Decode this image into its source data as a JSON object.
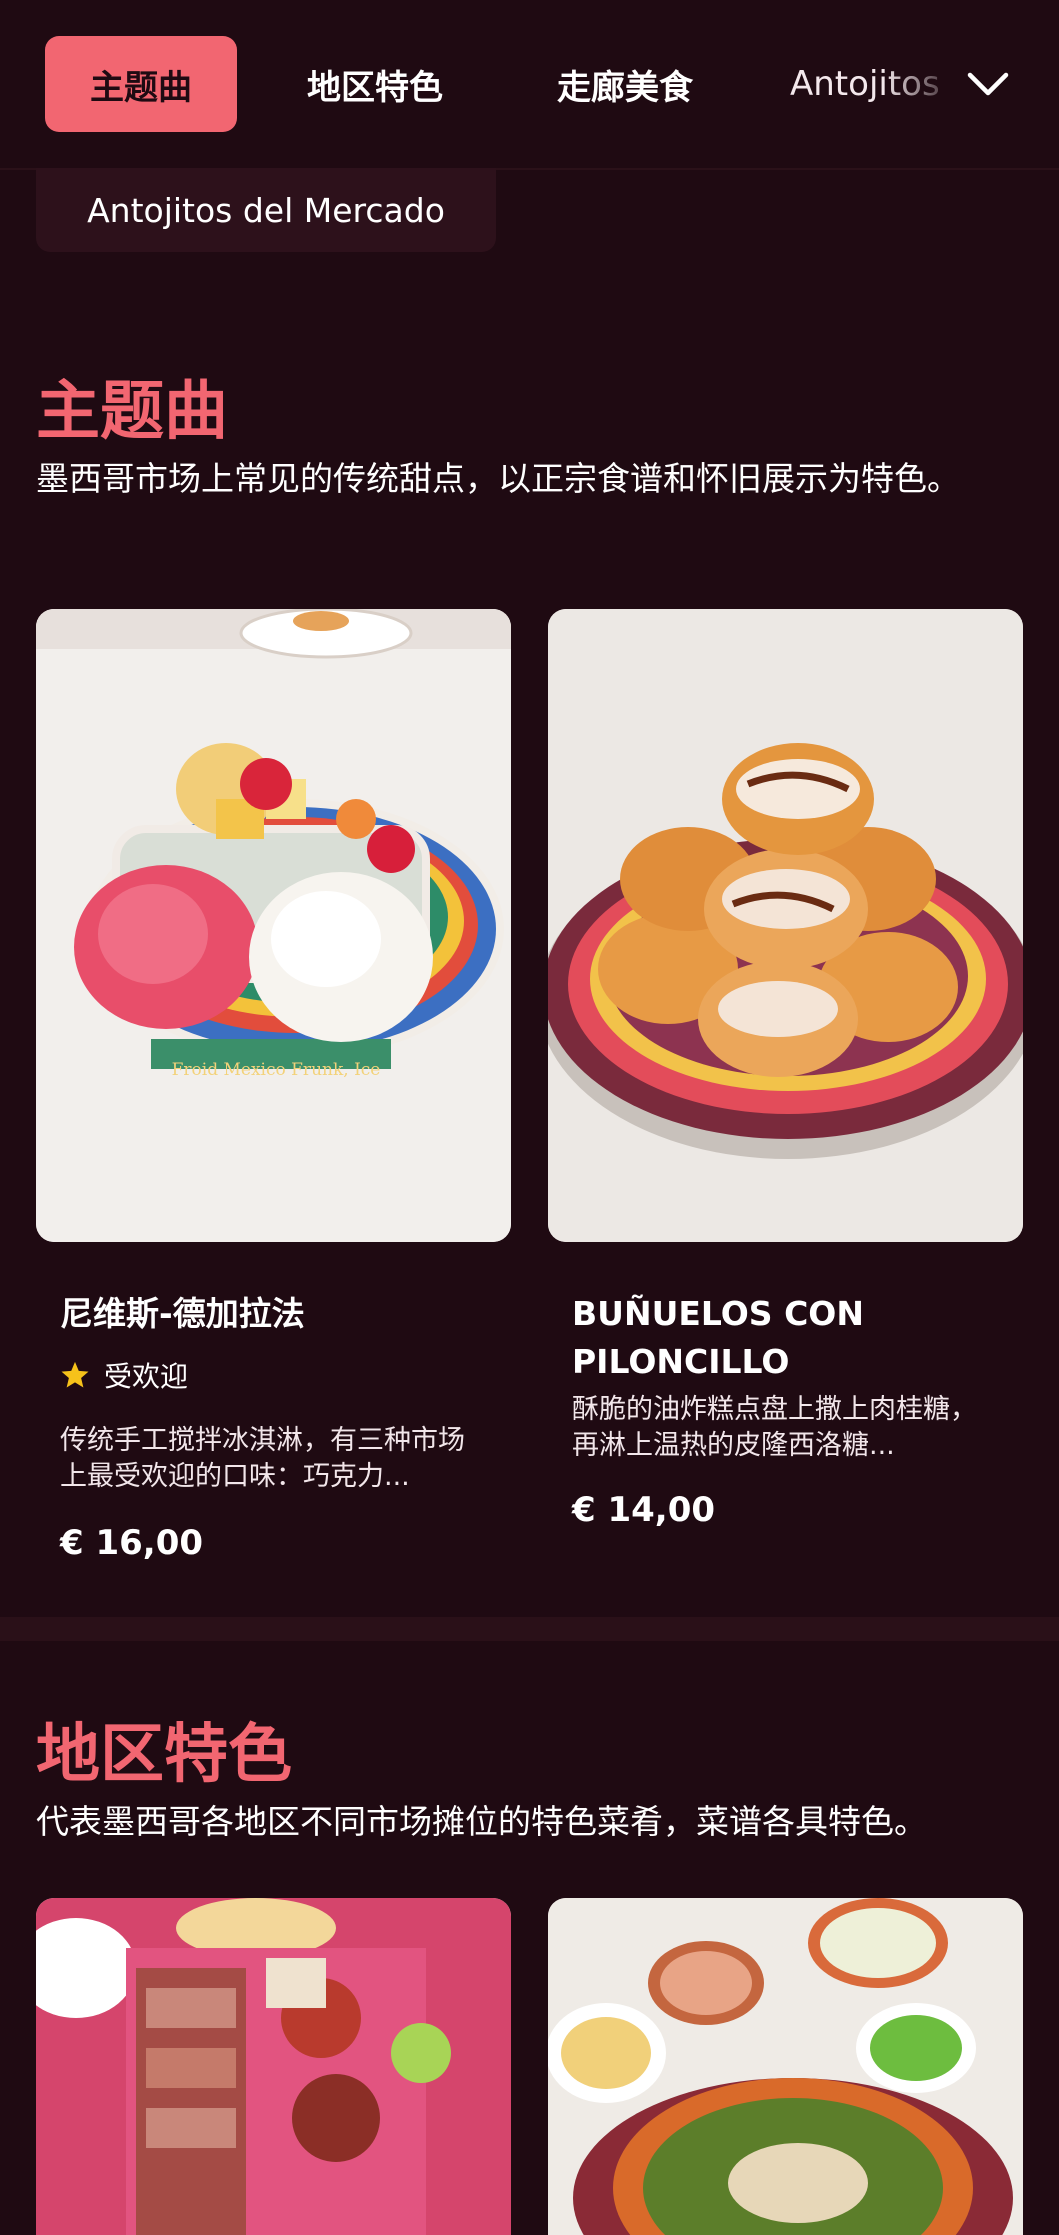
{
  "nav": {
    "tabs": [
      {
        "label": "主题曲",
        "active": true
      },
      {
        "label": "地区特色",
        "active": false
      },
      {
        "label": "走廊美食",
        "active": false
      },
      {
        "label": "Antojitos",
        "active": false
      }
    ],
    "expand_icon": "chevron-down-icon"
  },
  "subnav": {
    "label": "Antojitos del Mercado"
  },
  "sections": [
    {
      "title": "主题曲",
      "description": "墨西哥市场上常见的传统甜点，以正宗食谱和怀旧展示为特色。",
      "cards": [
        {
          "title": "尼维斯-德加拉法",
          "badge": "受欢迎",
          "badge_icon": "star-icon",
          "description": "传统手工搅拌冰淇淋，有三种市场上最受欢迎的口味：巧克力...",
          "price": "€ 16,00",
          "image_text": "Froid Mexico Frunk, Ice"
        },
        {
          "title": "BUÑUELOS CON PILONCILLO",
          "description": "酥脆的油炸糕点盘上撒上肉桂糖，再淋上温热的皮隆西洛糖...",
          "price": "€ 14,00"
        }
      ]
    },
    {
      "title": "地区特色",
      "description": "代表墨西哥各地区不同市场摊位的特色菜肴，菜谱各具特色。"
    }
  ],
  "colors": {
    "background": "#1f0a12",
    "accent": "#f26671",
    "surface": "#2d111b",
    "star": "#f6c21a"
  }
}
